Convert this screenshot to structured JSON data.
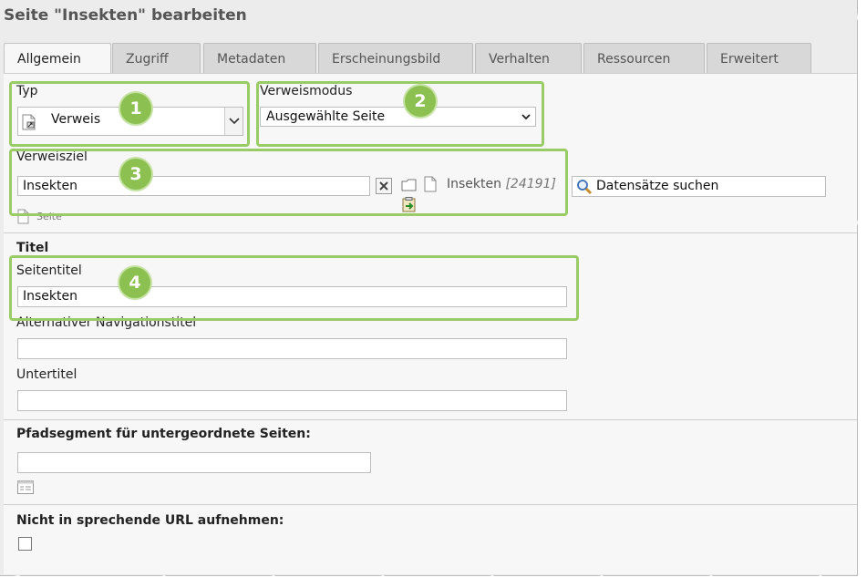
{
  "header": {
    "title": "Seite \"Insekten\" bearbeiten"
  },
  "tabs": [
    {
      "label": "Allgemein",
      "active": true
    },
    {
      "label": "Zugriff"
    },
    {
      "label": "Metadaten"
    },
    {
      "label": "Erscheinungsbild"
    },
    {
      "label": "Verhalten"
    },
    {
      "label": "Ressourcen"
    },
    {
      "label": "Erweitert"
    }
  ],
  "fields": {
    "typ": {
      "label": "Typ",
      "value": "Verweis",
      "icon": "page-link-icon"
    },
    "verweismodus": {
      "label": "Verweismodus",
      "value": "Ausgewählte Seite"
    },
    "verweisziel": {
      "label": "Verweisziel",
      "value": "Insekten",
      "selected_title": "Insekten",
      "selected_id": "[24191]",
      "search_label": "Datensätze suchen",
      "type_hint": "Seite"
    },
    "titel_section": {
      "label": "Titel"
    },
    "seitentitel": {
      "label": "Seitentitel",
      "value": "Insekten"
    },
    "alt_nav": {
      "label": "Alternativer Navigationstitel",
      "value": ""
    },
    "untertitel": {
      "label": "Untertitel",
      "value": ""
    },
    "pfadsegment": {
      "label": "Pfadsegment für untergeordnete Seiten:",
      "value": ""
    },
    "nicht_url": {
      "label": "Nicht in sprechende URL aufnehmen:",
      "checked": false
    }
  },
  "badges": [
    "1",
    "2",
    "3",
    "4"
  ],
  "colors": {
    "highlight": "#99cc66",
    "badge": "#8cc152"
  }
}
